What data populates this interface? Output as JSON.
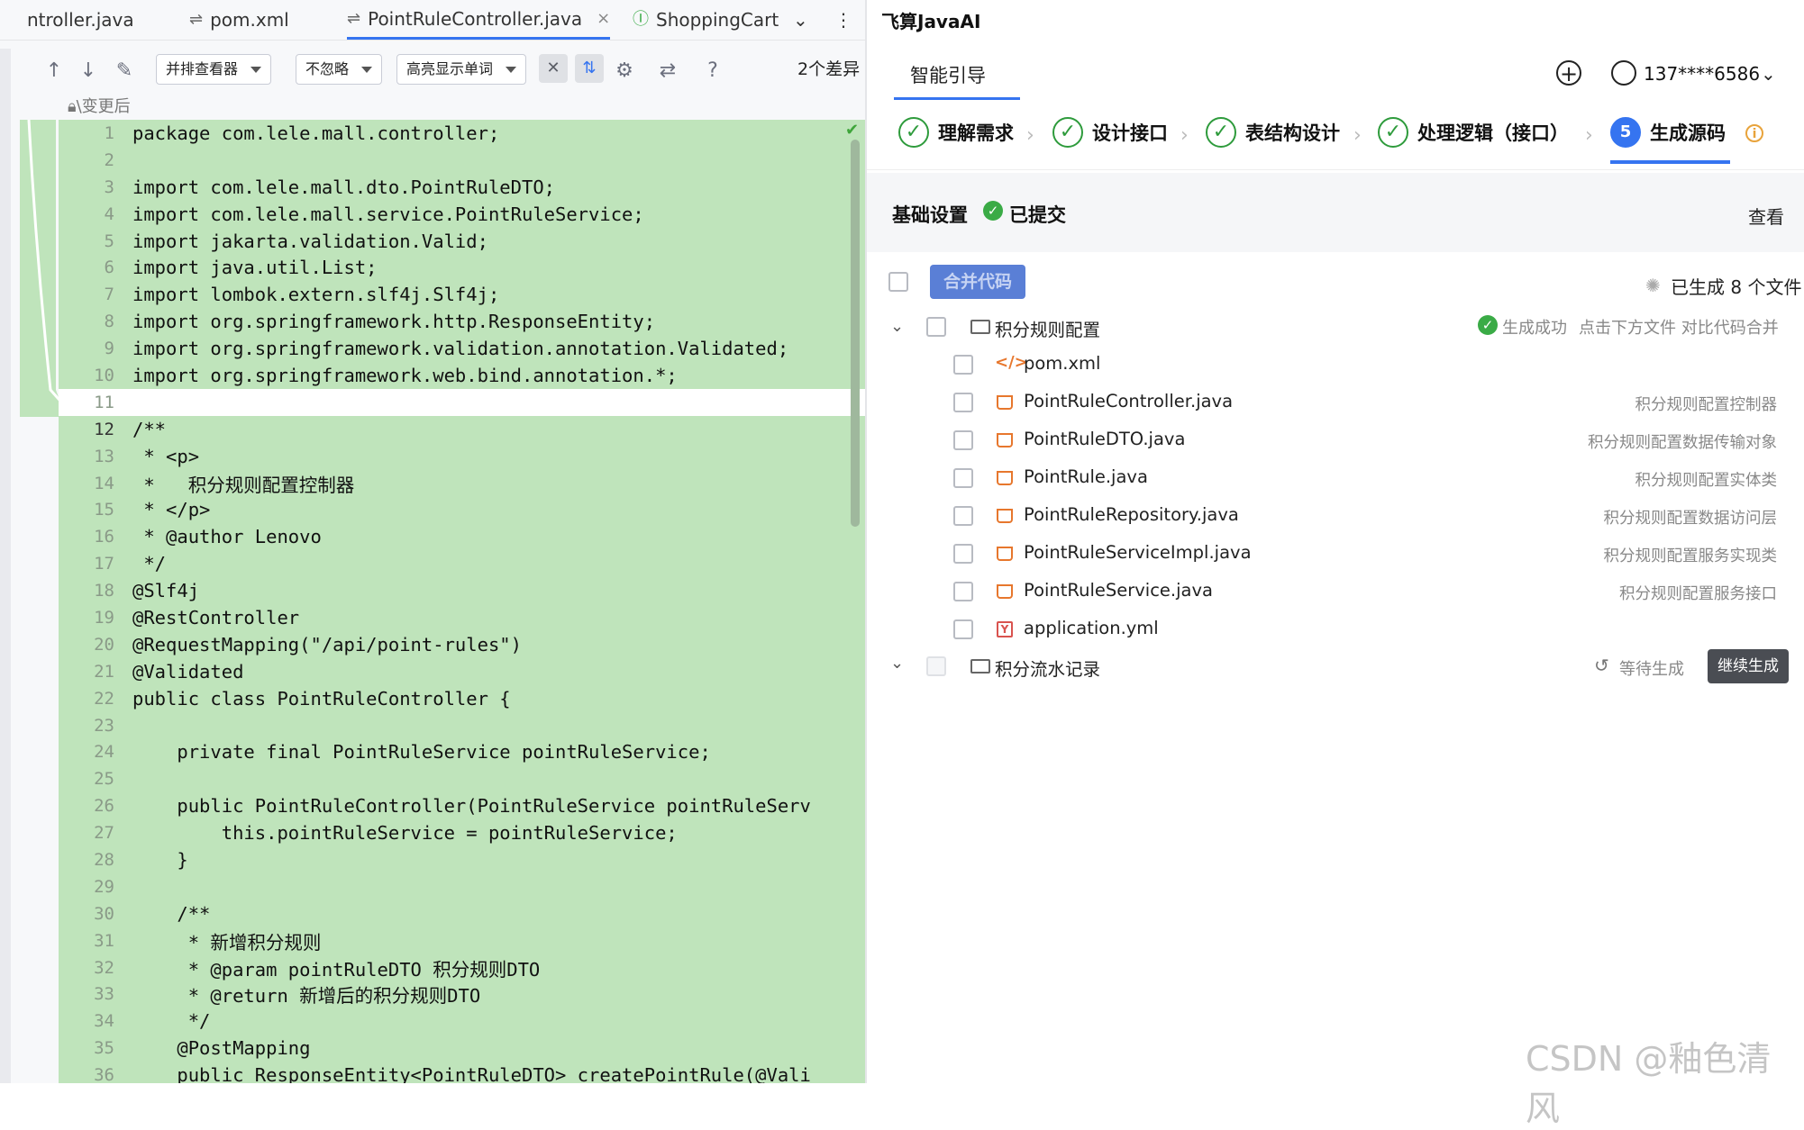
{
  "ide": {
    "tabs": [
      {
        "label": "ntroller.java",
        "icon": "diff-icon"
      },
      {
        "label": "pom.xml",
        "icon": "diff-icon"
      },
      {
        "label": "PointRuleController.java",
        "icon": "diff-icon",
        "active": true
      },
      {
        "label": "ShoppingCart",
        "icon": "interface-icon"
      }
    ],
    "toolbar": {
      "viewer": "并排查看器",
      "ignore": "不忽略",
      "highlight": "高亮显示单词",
      "diff_count": "2个差异"
    },
    "after_label": "\\变更后",
    "code_lines": [
      {
        "n": "1",
        "t": "package com.lele.mall.controller;"
      },
      {
        "n": "2",
        "t": ""
      },
      {
        "n": "3",
        "t": "import com.lele.mall.dto.PointRuleDTO;"
      },
      {
        "n": "4",
        "t": "import com.lele.mall.service.PointRuleService;"
      },
      {
        "n": "5",
        "t": "import jakarta.validation.Valid;"
      },
      {
        "n": "6",
        "t": "import java.util.List;"
      },
      {
        "n": "7",
        "t": "import lombok.extern.slf4j.Slf4j;"
      },
      {
        "n": "8",
        "t": "import org.springframework.http.ResponseEntity;"
      },
      {
        "n": "9",
        "t": "import org.springframework.validation.annotation.Validated;"
      },
      {
        "n": "10",
        "t": "import org.springframework.web.bind.annotation.*;"
      },
      {
        "n": "11",
        "t": ""
      },
      {
        "n": "12",
        "t": "/**"
      },
      {
        "n": "13",
        "t": " * <p>"
      },
      {
        "n": "14",
        "t": " *   积分规则配置控制器"
      },
      {
        "n": "15",
        "t": " * </p>"
      },
      {
        "n": "16",
        "t": " * @author Lenovo"
      },
      {
        "n": "17",
        "t": " */"
      },
      {
        "n": "18",
        "t": "@Slf4j"
      },
      {
        "n": "19",
        "t": "@RestController"
      },
      {
        "n": "20",
        "t": "@RequestMapping(\"/api/point-rules\")"
      },
      {
        "n": "21",
        "t": "@Validated"
      },
      {
        "n": "22",
        "t": "public class PointRuleController {"
      },
      {
        "n": "23",
        "t": ""
      },
      {
        "n": "24",
        "t": "    private final PointRuleService pointRuleService;"
      },
      {
        "n": "25",
        "t": ""
      },
      {
        "n": "26",
        "t": "    public PointRuleController(PointRuleService pointRuleServ"
      },
      {
        "n": "27",
        "t": "        this.pointRuleService = pointRuleService;"
      },
      {
        "n": "28",
        "t": "    }"
      },
      {
        "n": "29",
        "t": ""
      },
      {
        "n": "30",
        "t": "    /**"
      },
      {
        "n": "31",
        "t": "     * 新增积分规则"
      },
      {
        "n": "32",
        "t": "     * @param pointRuleDTO 积分规则DTO"
      },
      {
        "n": "33",
        "t": "     * @return 新增后的积分规则DTO"
      },
      {
        "n": "34",
        "t": "     */"
      },
      {
        "n": "35",
        "t": "    @PostMapping"
      },
      {
        "n": "36",
        "t": "    public ResponseEntity<PointRuleDTO> createPointRule(@Vali"
      }
    ]
  },
  "assistant": {
    "app_title": "飞算JavaAI",
    "tab": "智能引导",
    "user": "137****6586",
    "steps": [
      {
        "label": "理解需求",
        "done": true
      },
      {
        "label": "设计接口",
        "done": true
      },
      {
        "label": "表结构设计",
        "done": true
      },
      {
        "label": "处理逻辑（接口）",
        "done": true
      },
      {
        "label": "生成源码",
        "num": "5"
      }
    ],
    "basic": {
      "title": "基础设置",
      "status": "已提交",
      "view": "查看"
    },
    "merge_button": "合并代码",
    "generated_count": "已生成 8 个文件",
    "groups": [
      {
        "name": "积分规则配置",
        "status": "生成成功",
        "hint": "点击下方文件 对比代码合并",
        "files": [
          {
            "name": "pom.xml",
            "type": "xml",
            "desc": ""
          },
          {
            "name": "PointRuleController.java",
            "type": "java",
            "desc": "积分规则配置控制器"
          },
          {
            "name": "PointRuleDTO.java",
            "type": "java",
            "desc": "积分规则配置数据传输对象"
          },
          {
            "name": "PointRule.java",
            "type": "java",
            "desc": "积分规则配置实体类"
          },
          {
            "name": "PointRuleRepository.java",
            "type": "java",
            "desc": "积分规则配置数据访问层"
          },
          {
            "name": "PointRuleServiceImpl.java",
            "type": "java",
            "desc": "积分规则配置服务实现类"
          },
          {
            "name": "PointRuleService.java",
            "type": "java",
            "desc": "积分规则配置服务接口"
          },
          {
            "name": "application.yml",
            "type": "yml",
            "desc": ""
          }
        ]
      },
      {
        "name": "积分流水记录",
        "status": "等待生成",
        "button": "继续生成"
      }
    ]
  },
  "watermark": "CSDN @釉色清风"
}
